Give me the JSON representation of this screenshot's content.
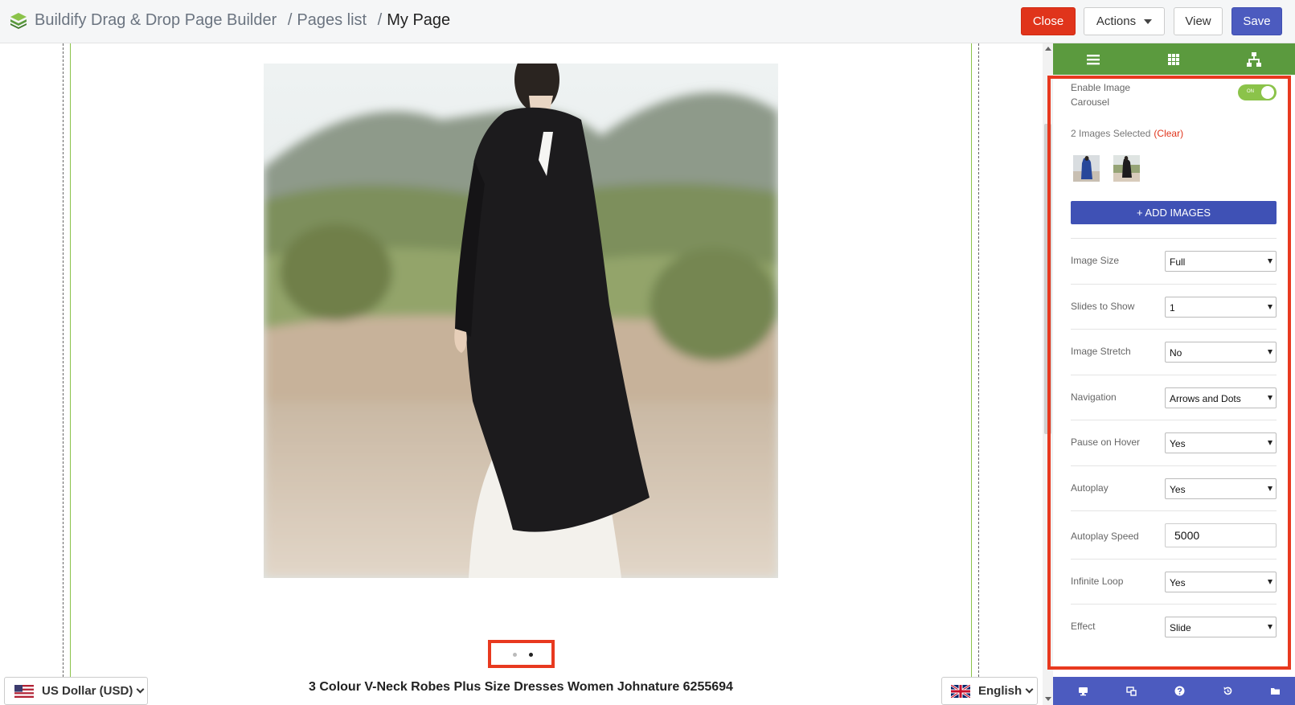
{
  "header": {
    "app_title": "Buildify Drag & Drop Page Builder",
    "breadcrumb_sep": "/",
    "breadcrumb_pages": "Pages list",
    "breadcrumb_current": "My Page",
    "buttons": {
      "close": "Close",
      "actions": "Actions",
      "view": "View",
      "save": "Save"
    },
    "colors": {
      "close": "#e0341b",
      "save": "#4c5bbf"
    }
  },
  "canvas": {
    "image_alt": "Woman in black long robe over white dress",
    "carousel_dots": 2,
    "active_dot": 2,
    "product_title": "3 Colour V-Neck Robes Plus Size Dresses Women Johnature 6255694",
    "currency": "US Dollar (USD)",
    "language": "English"
  },
  "panel": {
    "tab_icons": [
      "menu-icon",
      "grid-icon",
      "sitemap-icon"
    ],
    "enable_carousel_label": "Enable Image Carousel",
    "toggle_state": "ON",
    "images_selected": "2 Images Selected",
    "clear_label": "(Clear)",
    "add_images": "+ ADD IMAGES",
    "settings": [
      {
        "label": "Image Size",
        "value": "Full"
      },
      {
        "label": "Slides to Show",
        "value": "1"
      },
      {
        "label": "Image Stretch",
        "value": "No"
      },
      {
        "label": "Navigation",
        "value": "Arrows and Dots"
      },
      {
        "label": "Pause on Hover",
        "value": "Yes"
      },
      {
        "label": "Autoplay",
        "value": "Yes"
      },
      {
        "label": "Autoplay Speed",
        "value": "5000"
      },
      {
        "label": "Infinite Loop",
        "value": "Yes"
      },
      {
        "label": "Effect",
        "value": "Slide"
      }
    ],
    "footer_icons": [
      "desktop-icon",
      "responsive-icon",
      "help-icon",
      "history-icon",
      "folder-icon"
    ],
    "colors": {
      "tabs_bg": "#5b9a3e",
      "footer_bg": "#4c5bbf",
      "highlight": "#e8391f"
    }
  }
}
